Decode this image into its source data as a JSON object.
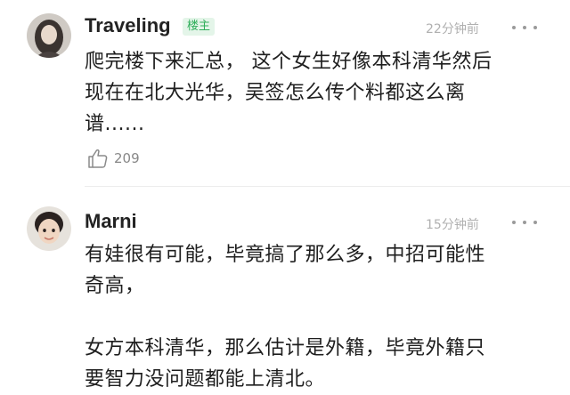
{
  "comments": [
    {
      "username": "Traveling",
      "badge": "楼主",
      "timestamp": "22分钟前",
      "lines": [
        "爬完楼下来汇总， 这个女生好像本科清华然后",
        "现在在北大光华，吴签怎么传个料都这么离",
        "谱......"
      ],
      "likes": "209"
    },
    {
      "username": "Marni",
      "timestamp": "15分钟前",
      "lines": [
        "有娃很有可能，毕竟搞了那么多，中招可能性",
        "奇高，",
        "",
        "女方本科清华，那么估计是外籍，毕竟外籍只",
        "要智力没问题都能上清北。"
      ]
    }
  ],
  "colors": {
    "badge_text": "#2fae5a",
    "badge_bg": "#e4f5e9",
    "timestamp": "#b0b0b0",
    "body_text": "#1e1e1e"
  },
  "icons": {
    "more": "more-dots-icon",
    "like": "thumbs-up-icon"
  }
}
